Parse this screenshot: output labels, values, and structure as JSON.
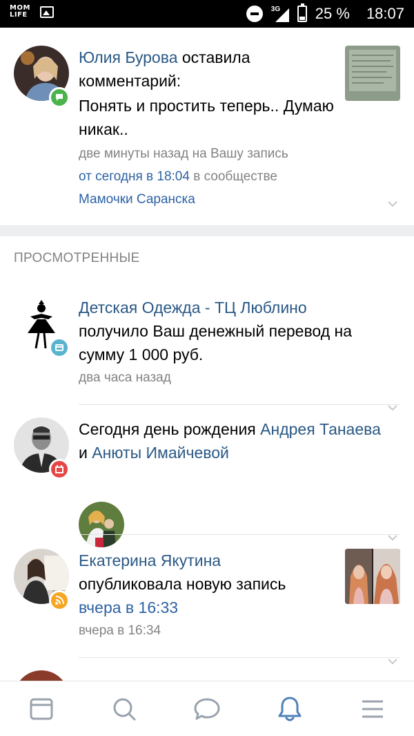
{
  "status_bar": {
    "app_label_line1": "MOM",
    "app_label_line2": "LIFE",
    "network": "3G",
    "battery": "25 %",
    "time": "18:07"
  },
  "notifications": [
    {
      "author": "Юлия Бурова",
      "action": " оставила комментарий:",
      "comment": "Понять и простить теперь.. Думаю никак..",
      "meta_prefix": "две минуты назад на Вашу запись",
      "meta_link": "от сегодня в 18:04",
      "meta_mid": " в сообществе",
      "community": "Мамочки Саранска",
      "badge_icon": "comment-icon",
      "badge_color": "#4bb34b"
    }
  ],
  "section_title": "ПРОСМОТРЕННЫЕ",
  "viewed": [
    {
      "author": "Детская Одежда - ТЦ Люблино",
      "text": "получило Ваш денежный перевод на сумму 1 000 руб.",
      "meta": "два часа назад",
      "badge_icon": "money-transfer-icon",
      "badge_color": "#5ab3cf"
    },
    {
      "text_prefix": "Сегодня день рождения ",
      "name1": "Андрея Танаева",
      "and": " и ",
      "name2": "Анюты Имайчевой",
      "badge_icon": "gift-icon",
      "badge_color": "#e64646"
    },
    {
      "author": "Екатерина Якутина",
      "text": "опубликовала новую запись",
      "link": "вчера в 16:33",
      "meta": "вчера в 16:34",
      "badge_icon": "rss-icon",
      "badge_color": "#f5a623"
    }
  ],
  "bottom_nav": {
    "items": [
      "news-icon",
      "search-icon",
      "messages-icon",
      "notifications-icon",
      "menu-icon"
    ],
    "active": "notifications-icon",
    "active_color": "#5181b8",
    "inactive_color": "#99a2ad"
  }
}
